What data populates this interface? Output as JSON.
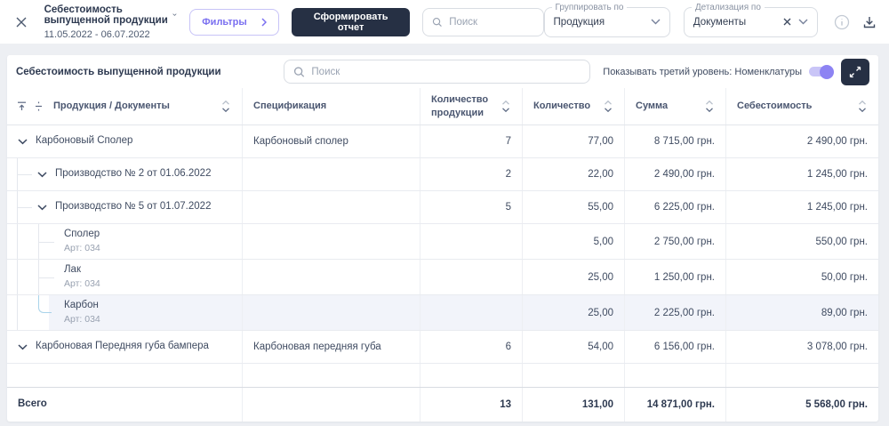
{
  "topbar": {
    "title": "Себестоимость выпущенной продукции",
    "date_range": "11.05.2022 - 06.07.2022",
    "filters_button": "Фильтры",
    "generate_button": "Сформировать отчет",
    "search_placeholder": "Поиск",
    "group_by": {
      "label": "Группировать по",
      "value": "Продукция"
    },
    "detail_by": {
      "label": "Детализация по",
      "value": "Документы"
    }
  },
  "report": {
    "title": "Себестоимость выпущенной продукции",
    "search_placeholder": "Поиск",
    "toggle_label": "Показывать третий уровень: Номенклатуры",
    "toggle_on": true
  },
  "table": {
    "columns": {
      "product": "Продукция / Документы",
      "spec": "Спецификация",
      "qty_prod": "Количество продукции",
      "qty": "Количество",
      "sum": "Сумма",
      "cost": "Себестоимость"
    },
    "currency_suffix": "грн.",
    "rows": [
      {
        "level": 1,
        "expandable": true,
        "name": "Карбоновый Сполер",
        "spec": "Карбоновый сполер",
        "qty_prod": "7",
        "qty": "77,00",
        "sum": "8 715,00 грн.",
        "cost": "2 490,00 грн."
      },
      {
        "level": 2,
        "expandable": true,
        "name": "Производство № 2 от 01.06.2022",
        "spec": "",
        "qty_prod": "2",
        "qty": "22,00",
        "sum": "2 490,00 грн.",
        "cost": "1 245,00 грн."
      },
      {
        "level": 2,
        "expandable": true,
        "name": "Производство № 5 от 01.07.2022",
        "spec": "",
        "qty_prod": "5",
        "qty": "55,00",
        "sum": "6 225,00 грн.",
        "cost": "1 245,00 грн."
      },
      {
        "level": 3,
        "name": "Сполер",
        "sub": "Арт: 034",
        "spec": "",
        "qty_prod": "",
        "qty": "5,00",
        "sum": "2 750,00 грн.",
        "cost": "550,00 грн."
      },
      {
        "level": 3,
        "name": "Лак",
        "sub": "Арт: 034",
        "spec": "",
        "qty_prod": "",
        "qty": "25,00",
        "sum": "1 250,00 грн.",
        "cost": "50,00 грн."
      },
      {
        "level": 3,
        "name": "Карбон",
        "sub": "Арт: 034",
        "spec": "",
        "qty_prod": "",
        "qty": "25,00",
        "sum": "2 225,00 грн.",
        "cost": "89,00 грн.",
        "highlighted": true,
        "last_child": true
      },
      {
        "level": 1,
        "expandable": true,
        "name": "Карбоновая Передняя губа бампера",
        "spec": "Карбоновая передняя губа",
        "qty_prod": "6",
        "qty": "54,00",
        "sum": "6 156,00 грн.",
        "cost": "3 078,00 грн."
      },
      {
        "level": 0,
        "spacer": true
      },
      {
        "level": 0,
        "total": true,
        "name": "Всего",
        "spec": "",
        "qty_prod": "13",
        "qty": "131,00",
        "sum": "14 871,00 грн.",
        "cost": "5 568,00 грн."
      }
    ]
  },
  "colors": {
    "accent_purple": "#7a6ff0",
    "dark_navy": "#263044",
    "page_bg": "#edeff3",
    "highlight_row": "#f2f4fa",
    "active_connector": "#a9d3ea"
  }
}
